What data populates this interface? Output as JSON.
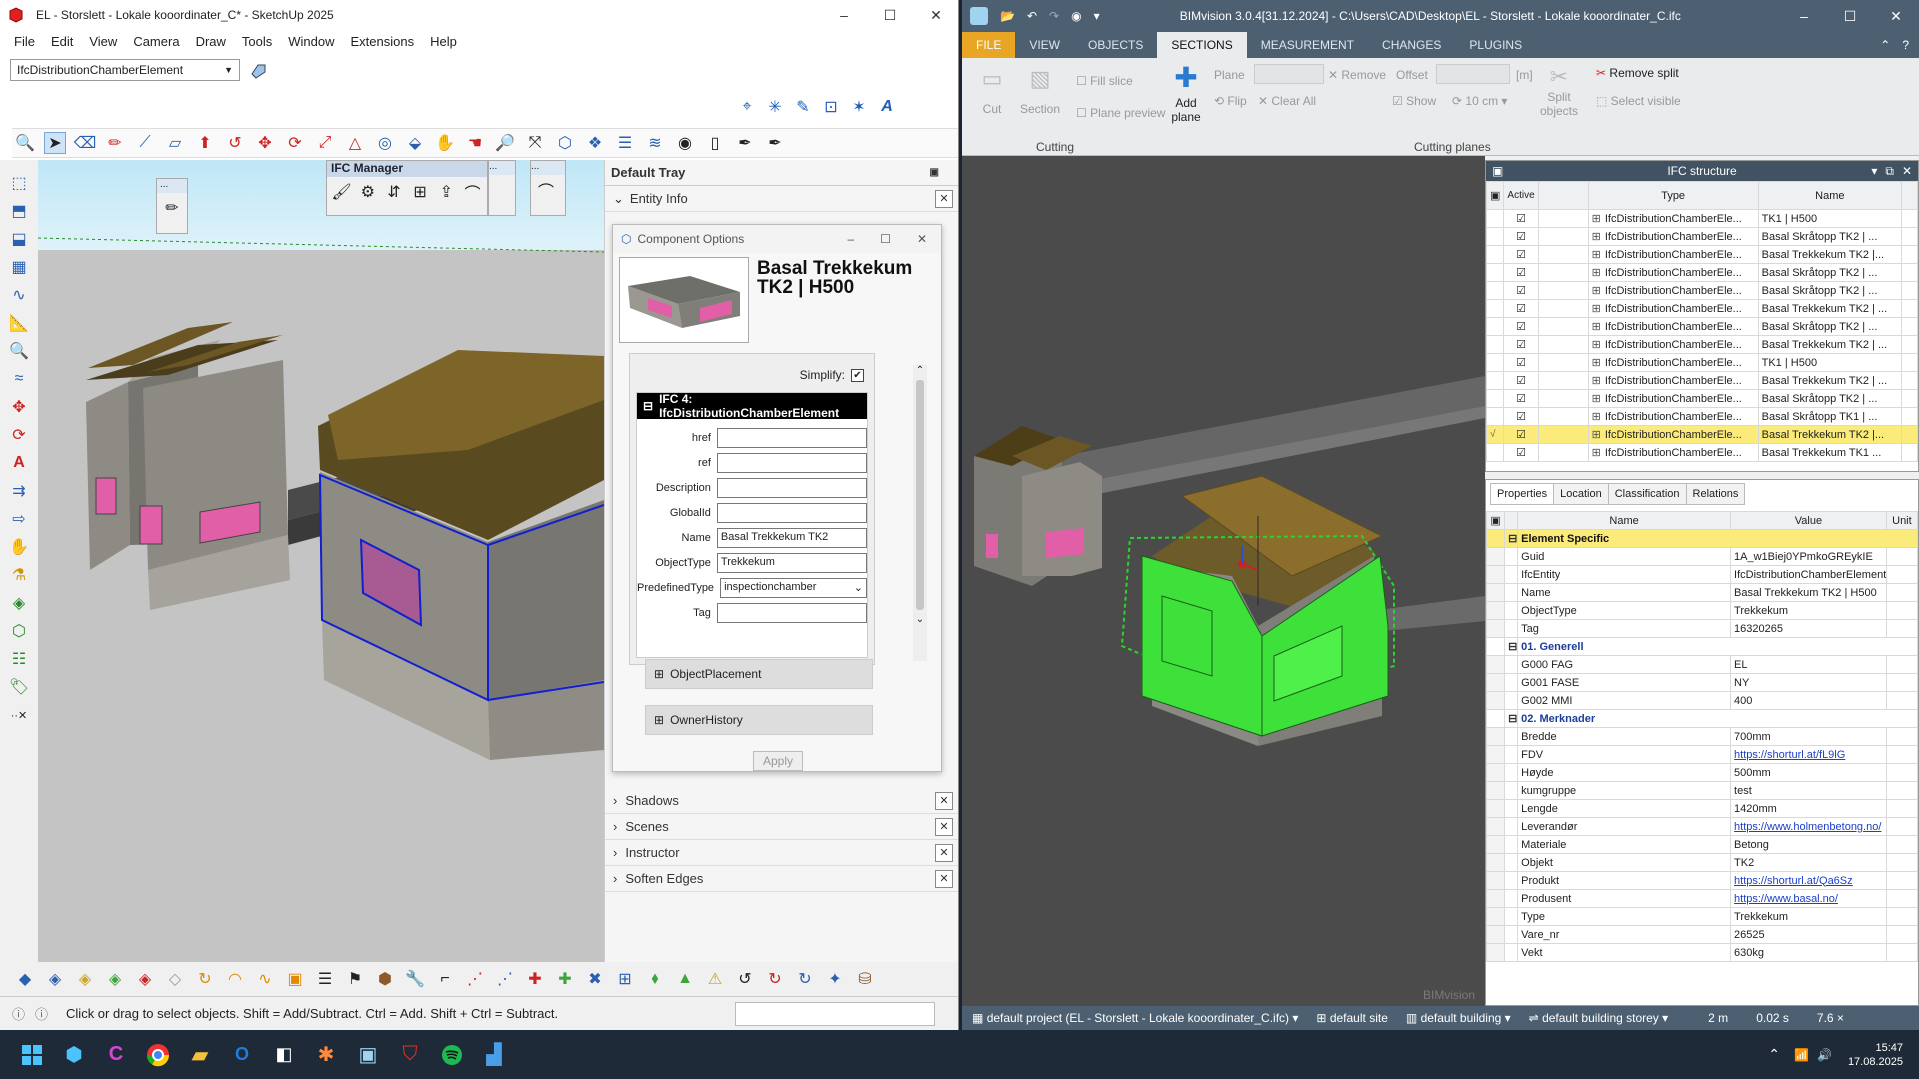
{
  "sketchup": {
    "title": "EL - Storslett - Lokale kooordinater_C* - SketchUp 2025",
    "menu": [
      "File",
      "Edit",
      "View",
      "Camera",
      "Draw",
      "Tools",
      "Window",
      "Extensions",
      "Help"
    ],
    "tag_selected": "IfcDistributionChamberElement",
    "ifc_manager_title": "IFC Manager",
    "small_panel_label": "...",
    "status_text": "Click or drag to select objects. Shift = Add/Subtract. Ctrl = Add. Shift + Ctrl = Subtract.",
    "tray": {
      "title": "Default Tray",
      "entity_info": "Entity Info",
      "shadows": "Shadows",
      "scenes": "Scenes",
      "instructor": "Instructor",
      "soften_edges": "Soften Edges"
    },
    "component_options": {
      "title": "Component Options",
      "component_name": "Basal Trekkekum TK2 | H500",
      "simplify_label": "Simplify:",
      "ifc_section": "IFC 4: IfcDistributionChamberElement",
      "fields": {
        "href": {
          "label": "href",
          "value": ""
        },
        "ref": {
          "label": "ref",
          "value": ""
        },
        "description": {
          "label": "Description",
          "value": ""
        },
        "globalid": {
          "label": "GlobalId",
          "value": ""
        },
        "name": {
          "label": "Name",
          "value": "Basal Trekkekum TK2"
        },
        "objecttype": {
          "label": "ObjectType",
          "value": "Trekkekum"
        },
        "predefinedtype": {
          "label": "PredefinedType",
          "value": "inspectionchamber"
        },
        "tag": {
          "label": "Tag",
          "value": ""
        }
      },
      "object_placement": "ObjectPlacement",
      "owner_history": "OwnerHistory",
      "apply_label": "Apply"
    }
  },
  "bimvision": {
    "title": "BIMvision 3.0.4[31.12.2024] - C:\\Users\\CAD\\Desktop\\EL - Storslett - Lokale kooordinater_C.ifc",
    "tabs": [
      "FILE",
      "VIEW",
      "OBJECTS",
      "SECTIONS",
      "MEASUREMENT",
      "CHANGES",
      "PLUGINS"
    ],
    "active_tab": "SECTIONS",
    "ribbon": {
      "cut": "Cut",
      "section": "Section",
      "fill_slice": "Fill slice",
      "plane_preview": "Plane preview",
      "add_plane": "Add plane",
      "plane": "Plane",
      "remove": "Remove",
      "flip": "Flip",
      "clear_all": "Clear All",
      "offset": "Offset",
      "unit_m": "[m]",
      "show": "Show",
      "ten_cm": "10 cm",
      "split_objects": "Split objects",
      "remove_split": "Remove split",
      "select_visible": "Select visible",
      "group_cutting": "Cutting",
      "group_cutting_planes": "Cutting planes"
    },
    "watermark": "BIMvision",
    "ifc_structure": {
      "title": "IFC structure",
      "col_active": "Active",
      "col_type": "Type",
      "col_name": "Name",
      "rows": [
        {
          "type": "IfcDistributionChamberEle...",
          "name": "TK1 | H500"
        },
        {
          "type": "IfcDistributionChamberEle...",
          "name": "Basal Skråtopp TK2 | ..."
        },
        {
          "type": "IfcDistributionChamberEle...",
          "name": "Basal Trekkekum TK2 |..."
        },
        {
          "type": "IfcDistributionChamberEle...",
          "name": "Basal Skråtopp TK2 | ..."
        },
        {
          "type": "IfcDistributionChamberEle...",
          "name": "Basal Skråtopp TK2 | ..."
        },
        {
          "type": "IfcDistributionChamberEle...",
          "name": "Basal Trekkekum TK2 | ..."
        },
        {
          "type": "IfcDistributionChamberEle...",
          "name": "Basal Skråtopp TK2 | ..."
        },
        {
          "type": "IfcDistributionChamberEle...",
          "name": "Basal Trekkekum TK2 | ..."
        },
        {
          "type": "IfcDistributionChamberEle...",
          "name": "TK1 | H500"
        },
        {
          "type": "IfcDistributionChamberEle...",
          "name": "Basal Trekkekum TK2 | ..."
        },
        {
          "type": "IfcDistributionChamberEle...",
          "name": "Basal Skråtopp TK2 | ..."
        },
        {
          "type": "IfcDistributionChamberEle...",
          "name": "Basal Skråtopp TK1 | ..."
        },
        {
          "type": "IfcDistributionChamberEle...",
          "name": "Basal Trekkekum TK2 |..."
        },
        {
          "type": "IfcDistributionChamberEle...",
          "name": "Basal Trekkekum TK1 ..."
        }
      ]
    },
    "properties": {
      "tabs": [
        "Properties",
        "Location",
        "Classification",
        "Relations"
      ],
      "col_name": "Name",
      "col_value": "Value",
      "col_unit": "Unit",
      "groups": [
        {
          "title": "Element Specific",
          "rows": [
            {
              "name": "Guid",
              "value": "1A_w1Biej0YPmkoGREykIE"
            },
            {
              "name": "IfcEntity",
              "value": "IfcDistributionChamberElement"
            },
            {
              "name": "Name",
              "value": "Basal Trekkekum TK2 | H500"
            },
            {
              "name": "ObjectType",
              "value": "Trekkekum"
            },
            {
              "name": "Tag",
              "value": "16320265"
            }
          ]
        },
        {
          "title": "01. Generell",
          "rows": [
            {
              "name": "G000 FAG",
              "value": "EL"
            },
            {
              "name": "G001 FASE",
              "value": "NY"
            },
            {
              "name": "G002 MMI",
              "value": "400"
            }
          ]
        },
        {
          "title": "02. Merknader",
          "rows": [
            {
              "name": "Bredde",
              "value": "700mm"
            },
            {
              "name": "FDV",
              "value": "https://shorturl.at/fL9lG",
              "link": true
            },
            {
              "name": "Høyde",
              "value": "500mm"
            },
            {
              "name": "kumgruppe",
              "value": "test"
            },
            {
              "name": "Lengde",
              "value": "1420mm"
            },
            {
              "name": "Leverandør",
              "value": "https://www.holmenbetong.no/",
              "link": true
            },
            {
              "name": "Materiale",
              "value": "Betong"
            },
            {
              "name": "Objekt",
              "value": "TK2"
            },
            {
              "name": "Produkt",
              "value": "https://shorturl.at/Qa6Sz",
              "link": true
            },
            {
              "name": "Produsent",
              "value": "https://www.basal.no/",
              "link": true
            },
            {
              "name": "Type",
              "value": "Trekkekum"
            },
            {
              "name": "Vare_nr",
              "value": "26525"
            },
            {
              "name": "Vekt",
              "value": "630kg"
            }
          ]
        }
      ]
    },
    "status": {
      "project": "default project (EL - Storslett - Lokale kooordinater_C.ifc)",
      "site": "default site",
      "building": "default building",
      "storey": "default building storey",
      "dist": "2 m",
      "time": "0.02 s",
      "zoom": "7.6 ×"
    }
  },
  "taskbar": {
    "time": "15:47",
    "date": "17.08.2025"
  },
  "colors": {
    "bv_header": "#4d6072",
    "file_tab": "#e8a624",
    "selection_green": "#3ee03a",
    "highlight_row": "#fbeb7a"
  }
}
